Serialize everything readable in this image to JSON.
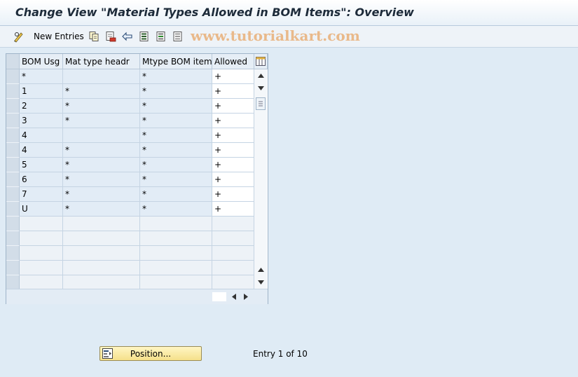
{
  "title": "Change View \"Material Types Allowed in BOM Items\": Overview",
  "toolbar": {
    "new_entries_label": "New Entries",
    "icons": [
      "pencil-glasses-icon",
      "copy-icon",
      "delete-icon",
      "undo-icon",
      "select-all-icon",
      "select-block-icon",
      "deselect-all-icon"
    ]
  },
  "watermark": "www.tutorialkart.com",
  "table": {
    "columns": [
      "BOM Usg",
      "Mat type headr",
      "Mtype BOM item",
      "Allowed"
    ],
    "rows": [
      [
        "*",
        "",
        "*",
        "+"
      ],
      [
        "1",
        "*",
        "*",
        "+"
      ],
      [
        "2",
        "*",
        "*",
        "+"
      ],
      [
        "3",
        "*",
        "*",
        "+"
      ],
      [
        "4",
        "",
        "*",
        "+"
      ],
      [
        "4",
        "*",
        "*",
        "+"
      ],
      [
        "5",
        "*",
        "*",
        "+"
      ],
      [
        "6",
        "*",
        "*",
        "+"
      ],
      [
        "7",
        "*",
        "*",
        "+"
      ],
      [
        "U",
        "*",
        "*",
        "+"
      ]
    ],
    "empty_rows": 5
  },
  "footer": {
    "position_button": "Position...",
    "entry_info": "Entry 1 of 10"
  }
}
